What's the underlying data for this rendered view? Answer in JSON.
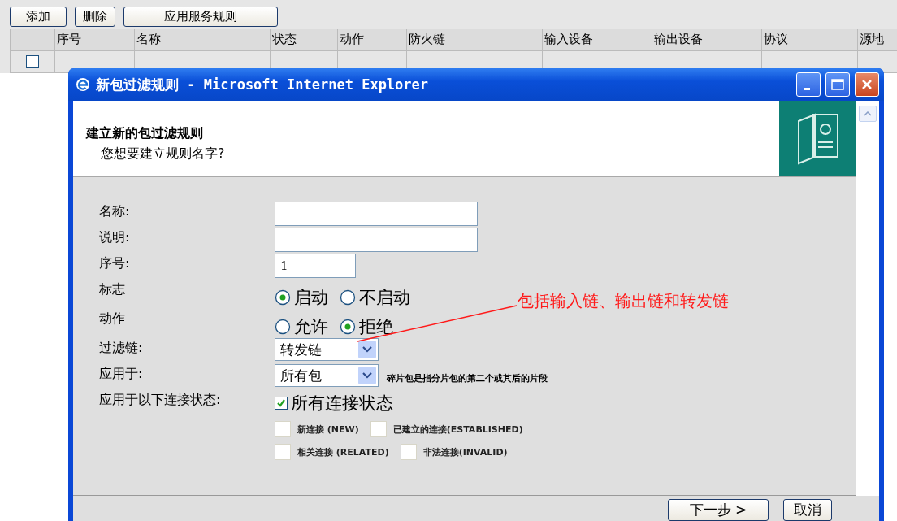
{
  "toolbar": {
    "buttons": [
      "添加",
      "删除",
      "应用服务规则"
    ]
  },
  "table": {
    "columns": [
      "",
      "序号",
      "名称",
      "状态",
      "动作",
      "防火链",
      "输入设备",
      "输出设备",
      "协议",
      "源地"
    ],
    "rows": [
      {
        "checked": false
      }
    ]
  },
  "dialog": {
    "title": "新包过滤规则 - Microsoft Internet Explorer",
    "header": {
      "title": "建立新的包过滤规则",
      "subtitle": "您想要建立规则名字?"
    },
    "fields": [
      {
        "kind": "text",
        "label": "名称:",
        "wide": true
      },
      {
        "kind": "text",
        "label": "说明:",
        "wide": true
      },
      {
        "kind": "text",
        "label": "序号:",
        "value": "1",
        "wide": false
      },
      {
        "kind": "radio",
        "label": "标志",
        "options": [
          {
            "label": "启动",
            "selected": true
          },
          {
            "label": "不启动",
            "selected": false
          }
        ]
      },
      {
        "kind": "radio",
        "label": "动作",
        "options": [
          {
            "label": "允许",
            "selected": false
          },
          {
            "label": "拒绝",
            "selected": true
          }
        ]
      },
      {
        "kind": "select",
        "label": "过滤链:",
        "value": "转发链"
      },
      {
        "kind": "select",
        "label": "应用于:",
        "value": "所有包",
        "note": "碎片包是指分片包的第二个或其后的片段"
      },
      {
        "kind": "checks",
        "label": "应用于以下连接状态:",
        "main": {
          "label": "所有连接状态",
          "checked": true
        },
        "options": [
          [
            {
              "label": "新连接 (NEW)",
              "checked": false
            },
            {
              "label": "已建立的连接(ESTABLISHED)",
              "checked": false
            }
          ],
          [
            {
              "label": "相关连接 (RELATED)",
              "checked": false
            },
            {
              "label": "非法连接(INVALID)",
              "checked": false
            }
          ]
        ]
      }
    ],
    "annotation": "包括输入链、输出链和转发链",
    "buttons": [
      "下一步 >",
      "取消"
    ]
  }
}
